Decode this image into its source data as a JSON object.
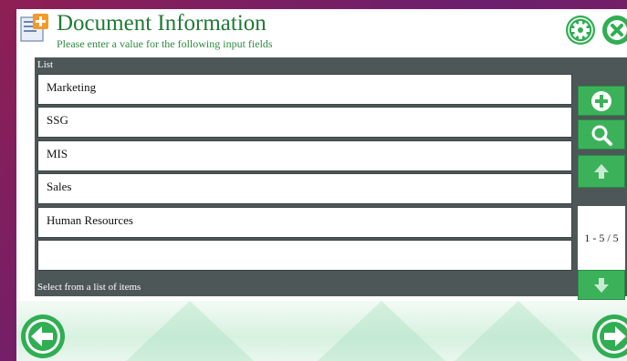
{
  "header": {
    "title": "Document Information",
    "subtitle": "Please enter a value for the following input fields"
  },
  "icons": {
    "app": "document-app-icon",
    "settings": "gear-icon",
    "close": "close-icon",
    "add": "plus-circle-icon",
    "search": "search-icon",
    "up": "arrow-up-icon",
    "down": "arrow-down-icon",
    "back": "arrow-left-icon",
    "next": "arrow-right-icon"
  },
  "list": {
    "label": "List",
    "items": [
      "Marketing",
      "SSG",
      "MIS",
      "Sales",
      "Human Resources",
      ""
    ],
    "footer": "Select from a list of items",
    "pager": "1 - 5 / 5"
  },
  "colors": {
    "accent": "#3bb25a",
    "title": "#1f7a36",
    "panel": "#4d5757"
  }
}
